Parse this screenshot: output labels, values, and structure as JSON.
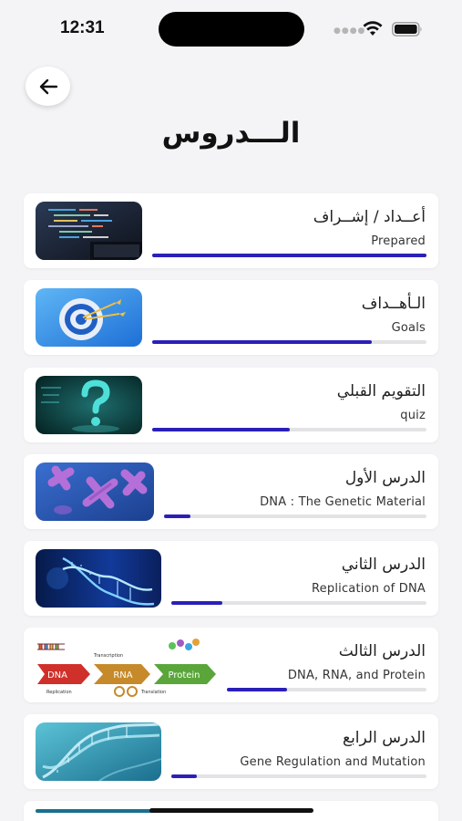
{
  "status_bar": {
    "time": "12:31"
  },
  "header": {
    "title": "الـــدروس"
  },
  "lessons": [
    {
      "title_ar": "أعــداد / إشــراف",
      "subtitle_en": "Prepared",
      "progress": 1.0
    },
    {
      "title_ar": "الـأهــداف",
      "subtitle_en": "Goals",
      "progress": 0.8
    },
    {
      "title_ar": "التقويم القبلي",
      "subtitle_en": "quiz",
      "progress": 0.5
    },
    {
      "title_ar": "الدرس الأول",
      "subtitle_en": "DNA : The Genetic Material",
      "progress": 0.1
    },
    {
      "title_ar": "الدرس الثاني",
      "subtitle_en": "Replication of DNA",
      "progress": 0.2
    },
    {
      "title_ar": "الدرس الثالث",
      "subtitle_en": "DNA, RNA, and Protein",
      "progress": 0.3
    },
    {
      "title_ar": "الدرس الرابع",
      "subtitle_en": "Gene Regulation and Mutation",
      "progress": 0.1
    }
  ],
  "thumbnail_labels": {
    "dna": "DNA",
    "rna": "RNA",
    "protein": "Protein",
    "transcription": "Transcription",
    "translation": "Translation",
    "replication": "Replication"
  },
  "colors": {
    "accent": "#2b1fb8",
    "track": "#e3e3e6"
  }
}
